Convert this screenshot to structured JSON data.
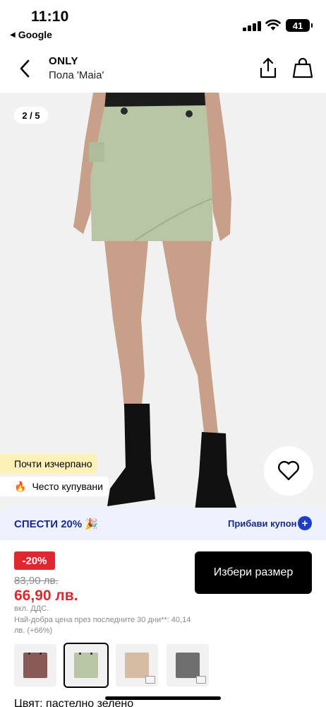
{
  "status_bar": {
    "time": "11:10",
    "back_app": "Google",
    "battery": "41"
  },
  "header": {
    "brand": "ONLY",
    "product_name": "Пола 'Maia'"
  },
  "gallery": {
    "counter": "2 / 5",
    "stock_badge": "Почти изчерпано",
    "popular_badge": "Често купувани",
    "popular_icon": "fire-icon"
  },
  "coupon": {
    "text": "СПЕСТИ 20% 🎉",
    "link": "Прибави купон",
    "plus": "+"
  },
  "price": {
    "discount": "-20%",
    "old": "83,90 лв.",
    "new": "66,90 лв.",
    "vat": "вкл. ДДС.",
    "best_price_note": "Най-добра цена през последните 30 дни**: 40,14 лв. (+66%)"
  },
  "actions": {
    "select_size": "Избери размер"
  },
  "variants": [
    {
      "name": "brown",
      "color": "#8a5a57"
    },
    {
      "name": "pastel-green",
      "color": "#b9c6a6"
    },
    {
      "name": "beige",
      "color": "#d6bca3"
    },
    {
      "name": "grey",
      "color": "#6f6f6f"
    }
  ],
  "color_label": "Цвят: пастелно зелено",
  "colors": {
    "accent_red": "#e0262f",
    "coupon_blue": "#1a2b8f",
    "stock_yellow": "#fdf1b8"
  }
}
